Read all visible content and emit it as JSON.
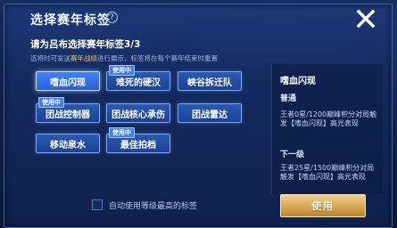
{
  "dialog": {
    "title": "选择赛年标签",
    "help_icon": "question-circle-icon",
    "close_icon": "close-x-icon",
    "subtitle": "请为吕布选择赛年标签3/3",
    "desc_pre": "选将时可发送",
    "desc_highlight": "赛年战绩",
    "desc_post": "进行展示，标签将在每个赛年结束时重置",
    "highlight_color": "#f2c35a"
  },
  "tags": [
    {
      "label": "嗜血闪现",
      "badge": "",
      "selected": true
    },
    {
      "label": "难死的硬汉",
      "badge": "使用中",
      "selected": false
    },
    {
      "label": "峡谷拆迁队",
      "badge": "",
      "selected": false
    },
    {
      "label": "团战控制器",
      "badge": "使用中",
      "selected": false
    },
    {
      "label": "团战核心承伤",
      "badge": "",
      "selected": false
    },
    {
      "label": "团战雷达",
      "badge": "",
      "selected": false
    },
    {
      "label": "移动泉水",
      "badge": "",
      "selected": false
    },
    {
      "label": "最佳拍档",
      "badge": "使用中",
      "selected": false
    }
  ],
  "auto_use": {
    "label": "自动使用等级最高的标签",
    "checked": false
  },
  "detail": {
    "title": "嗜血闪现",
    "level1_name": "普通",
    "level1_text": "王者0星/1200巅峰积分对局触发【嗜血闪现】高光表现",
    "level2_name": "下一级",
    "level2_text": "王者25星/1500巅峰积分对局触发【嗜血闪现】高光表现"
  },
  "use_button": {
    "label": "使用"
  },
  "colors": {
    "panel": "#1d3a78",
    "tag": "#2a5ab0",
    "tag_selected": "#3f82ff",
    "use_button": "#d7a654"
  }
}
